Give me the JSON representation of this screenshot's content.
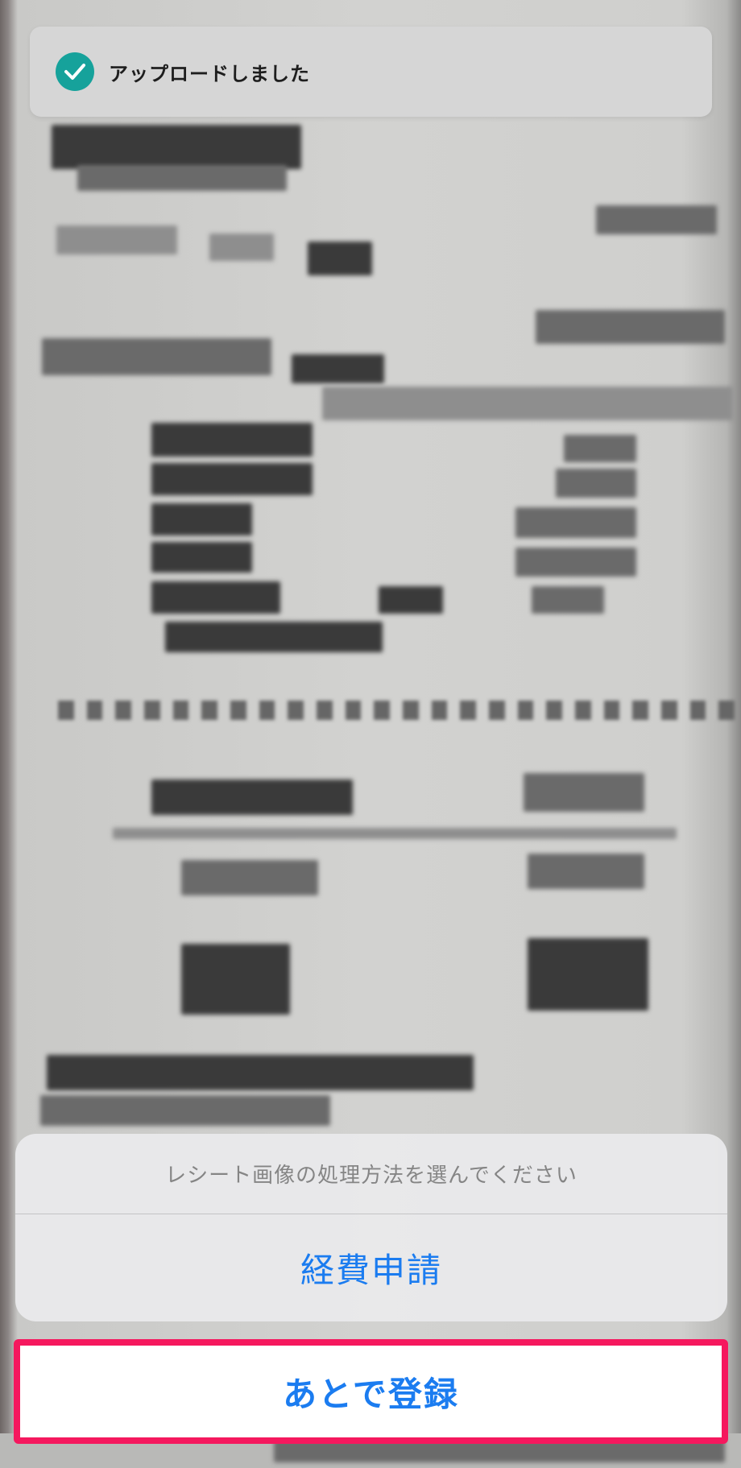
{
  "toast": {
    "icon": "check-circle-icon",
    "message": "アップロードしました",
    "icon_color": "#16a29b"
  },
  "action_sheet": {
    "title": "レシート画像の処理方法を選んでください",
    "option_expense": "経費申請",
    "accent_color": "#1b7cf0"
  },
  "cancel": {
    "label": "あとで登録",
    "highlight_color": "#f5185e"
  }
}
